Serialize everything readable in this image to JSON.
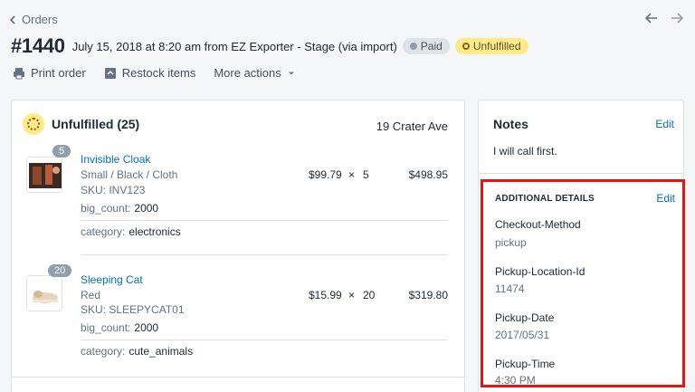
{
  "nav": {
    "back_label": "Orders"
  },
  "order": {
    "number": "#1440",
    "date": "July 15, 2018 at 8:20 am from EZ Exporter - Stage (via import)",
    "paid_badge": "Paid",
    "unfulfilled_badge": "Unfulfilled"
  },
  "actions": {
    "print": "Print order",
    "restock": "Restock items",
    "more": "More actions"
  },
  "fulfillment": {
    "title": "Unfulfilled (25)",
    "address": "19 Crater Ave",
    "items": [
      {
        "qty_badge": "5",
        "name": "Invisible Cloak",
        "variant": "Small / Black / Cloth",
        "sku": "SKU: INV123",
        "price": "$99.79",
        "times": "×",
        "qty": "5",
        "total": "$498.95",
        "props": [
          {
            "key": "big_count:",
            "value": "2000"
          },
          {
            "key": "category:",
            "value": "electronics"
          }
        ]
      },
      {
        "qty_badge": "20",
        "name": "Sleeping Cat",
        "variant": "Red",
        "sku": "SKU: SLEEPYCAT01",
        "price": "$15.99",
        "times": "×",
        "qty": "20",
        "total": "$319.80",
        "props": [
          {
            "key": "big_count:",
            "value": "2000"
          },
          {
            "key": "category:",
            "value": "cute_animals"
          }
        ]
      }
    ]
  },
  "notes": {
    "title": "Notes",
    "edit": "Edit",
    "text": "I will call first."
  },
  "additional": {
    "title": "ADDITIONAL DETAILS",
    "edit": "Edit",
    "fields": [
      {
        "key": "Checkout-Method",
        "value": "pickup"
      },
      {
        "key": "Pickup-Location-Id",
        "value": "11474"
      },
      {
        "key": "Pickup-Date",
        "value": "2017/05/31"
      },
      {
        "key": "Pickup-Time",
        "value": "4:30 PM"
      }
    ]
  },
  "colors": {
    "link": "#006fbb",
    "highlight_border": "#e31515",
    "unfulfilled_badge_bg": "#ffea8a",
    "paid_badge_bg": "#dfe3e8"
  }
}
